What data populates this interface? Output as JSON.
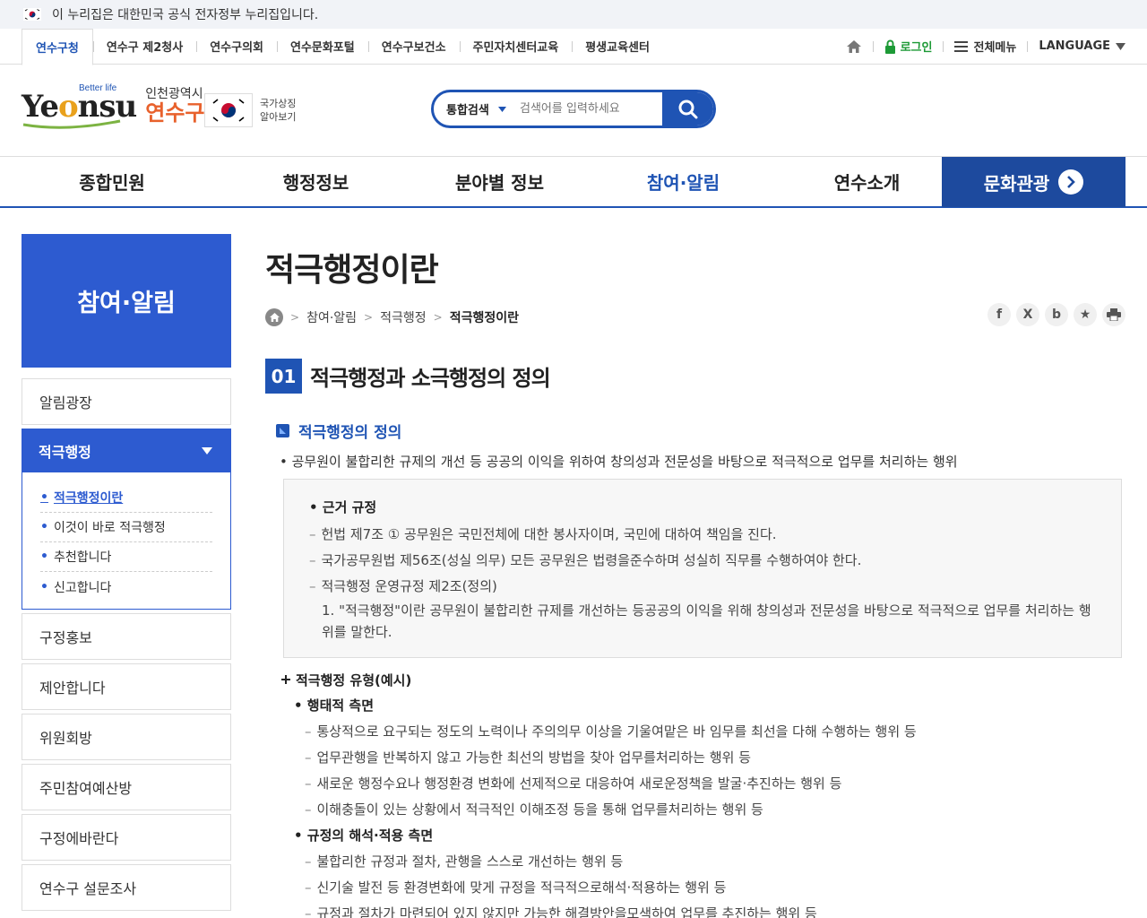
{
  "gov_banner": {
    "text": "이 누리집은 대한민국 공식 전자정부 누리집입니다."
  },
  "top_sites": [
    "연수구청",
    "연수구 제2청사",
    "연수구의회",
    "연수문화포털",
    "연수구보건소",
    "주민자치센터교육",
    "평생교육센터"
  ],
  "top_utils": {
    "login": "로그인",
    "all_menu": "전체메뉴",
    "language": "LANGUAGE"
  },
  "logo": {
    "better": "Better life",
    "word_pre": "Ye",
    "word_o": "o",
    "word_post": "nsu",
    "city_small": "인천광역시",
    "city_big": "연수구"
  },
  "national_symbol": {
    "line1": "국가상징",
    "line2": "알아보기"
  },
  "search": {
    "scope": "통합검색",
    "placeholder": "검색어를 입력하세요"
  },
  "gnb": [
    "종합민원",
    "행정정보",
    "분야별 정보",
    "참여·알림",
    "연수소개"
  ],
  "gnb_culture": "문화관광",
  "lnb": {
    "title": "참여·알림",
    "before": [
      "알림광장"
    ],
    "open": {
      "label": "적극행정",
      "subs": [
        "적극행정이란",
        "이것이 바로 적극행정",
        "추천합니다",
        "신고합니다"
      ]
    },
    "after": [
      "구정홍보",
      "제안합니다",
      "위원회방",
      "주민참여예산방",
      "구정에바란다",
      "연수구 설문조사"
    ]
  },
  "content": {
    "title": "적극행정이란",
    "breadcrumb": [
      "참여·알림",
      "적극행정",
      "적극행정이란"
    ],
    "section_num": "01",
    "section_title": "적극행정과 소극행정의 정의",
    "sub_title": "적극행정의 정의",
    "definition": "• 공무원이 불합리한 규제의 개선 등 공공의 이익을 위하여 창의성과 전문성을 바탕으로 적극적으로 업무를 처리하는 행위",
    "box": {
      "head": "• 근거 규정",
      "l1": "헌법 제7조 ① 공무원은 국민전체에 대한 봉사자이며, 국민에 대하여 책임을 진다.",
      "l2": "국가공무원법 제56조(성실 의무) 모든 공무원은 법령을준수하며 성실히 직무를 수행하여야 한다.",
      "l3": "적극행정 운영규정 제2조(정의)",
      "l3_sub": "1. \"적극행정\"이란 공무원이 불합리한 규제를 개선하는 등공공의 이익을 위해 창의성과 전문성을 바탕으로 적극적으로 업무를 처리하는 행위를 말한다."
    },
    "types": {
      "head": "적극행정 유형(예시)",
      "g1": "• 행태적 측면",
      "g1_items": [
        "통상적으로 요구되는 정도의 노력이나 주의의무 이상을 기울여맡은 바 임무를 최선을 다해 수행하는 행위 등",
        "업무관행을 반복하지 않고 가능한 최선의 방법을 찾아 업무를처리하는 행위 등",
        "새로운 행정수요나 행정환경 변화에 선제적으로 대응하여 새로운정책을 발굴·추진하는 행위 등",
        "이해충돌이 있는 상황에서 적극적인 이해조정 등을 통해 업무를처리하는 행위 등"
      ],
      "g2": "• 규정의 해석·적용 측면",
      "g2_items": [
        "불합리한 규정과 절차, 관행을 스스로 개선하는 행위 등",
        "신기술 발전 등 환경변화에 맞게 규정을 적극적으로해석·적용하는 행위 등",
        "규정과 절차가 마련되어 있지 않지만 가능한 해결방안을모색하여 업무를 추진하는 행위 등"
      ]
    }
  }
}
